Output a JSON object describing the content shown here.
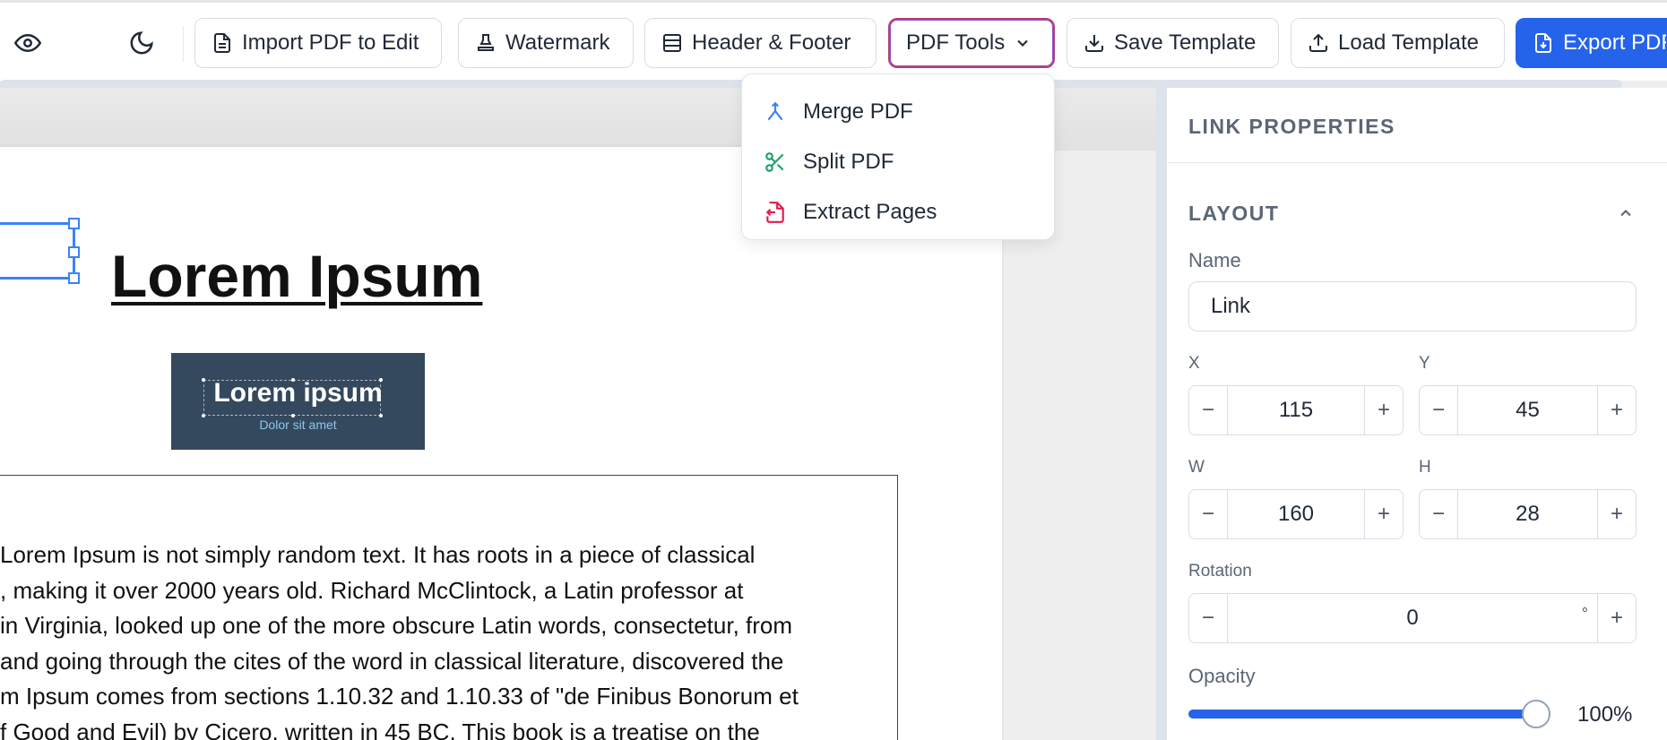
{
  "toolbar": {
    "import_label": "Import PDF to Edit",
    "watermark_label": "Watermark",
    "header_footer_label": "Header & Footer",
    "pdf_tools_label": "PDF Tools",
    "save_template_label": "Save Template",
    "load_template_label": "Load Template",
    "export_label": "Export PDF",
    "icons": [
      "eye-icon",
      "moon-icon",
      "file-text-icon",
      "stamp-icon",
      "layout-icon",
      "chevron-down-icon",
      "download-icon",
      "upload-icon",
      "file-export-icon"
    ]
  },
  "pdf_tools_menu": {
    "items": [
      {
        "label": "Merge PDF",
        "icon": "merge-icon",
        "color": "#3b82f6"
      },
      {
        "label": "Split PDF",
        "icon": "scissors-icon",
        "color": "#22a06b"
      },
      {
        "label": "Extract Pages",
        "icon": "file-extract-icon",
        "color": "#e11d48"
      }
    ]
  },
  "document": {
    "title": "Lorem Ipsum",
    "logo_title": "Lorem ipsum",
    "logo_subtitle": "Dolor sit amet",
    "body_lines": [
      " Lorem Ipsum is not simply random text. It has roots in a piece of classical",
      ", making it over 2000 years old. Richard McClintock, a Latin professor at",
      " in Virginia, looked up one of the more obscure Latin words, consectetur, from",
      "and going through the cites of the word in classical literature, discovered the",
      "m Ipsum comes from sections 1.10.32 and 1.10.33 of \"de Finibus Bonorum et",
      "f Good and Evil) by Cicero, written in 45 BC. This book is a treatise on the"
    ]
  },
  "panel": {
    "title": "LINK PROPERTIES",
    "section": "LAYOUT",
    "name_label": "Name",
    "name_value": "Link",
    "x_label": "X",
    "x_value": "115",
    "y_label": "Y",
    "y_value": "45",
    "w_label": "W",
    "w_value": "160",
    "h_label": "H",
    "h_value": "28",
    "rotation_label": "Rotation",
    "rotation_value": "0",
    "rotation_unit": "°",
    "opacity_label": "Opacity",
    "opacity_value": "100%",
    "opacity_fraction": 1.0,
    "minus": "−",
    "plus": "+"
  },
  "colors": {
    "accent": "#2563eb",
    "selection": "#3b82f6",
    "logo_bg": "#34495e"
  }
}
